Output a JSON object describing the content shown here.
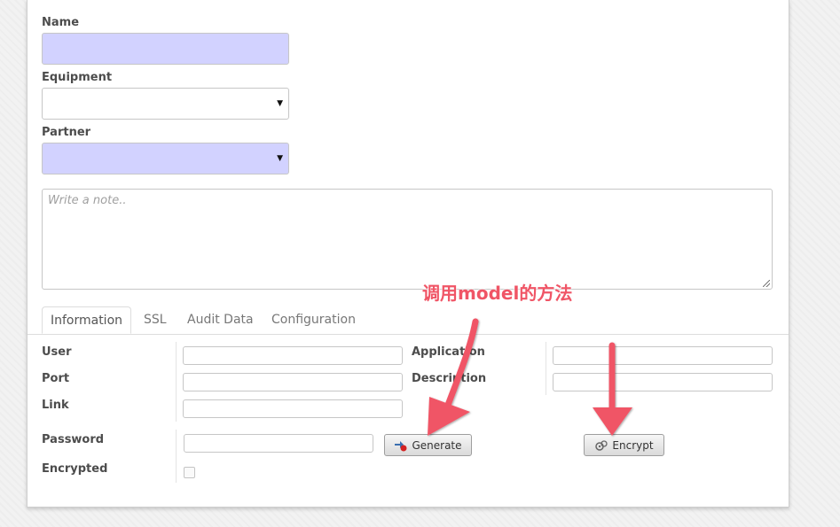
{
  "form": {
    "name_label": "Name",
    "name_value": "",
    "equipment_label": "Equipment",
    "equipment_value": "",
    "partner_label": "Partner",
    "partner_value": "",
    "note_placeholder": "Write a note..",
    "caret": "▼"
  },
  "tabs": [
    {
      "label": "Information",
      "active": true
    },
    {
      "label": "SSL",
      "active": false
    },
    {
      "label": "Audit Data",
      "active": false
    },
    {
      "label": "Configuration",
      "active": false
    }
  ],
  "info": {
    "user_label": "User",
    "port_label": "Port",
    "link_label": "Link",
    "application_label": "Application",
    "description_label": "Description",
    "password_label": "Password",
    "encrypted_label": "Encrypted",
    "encrypted_checked": false
  },
  "buttons": {
    "generate_label": "Generate",
    "encrypt_label": "Encrypt"
  },
  "annotation": {
    "text": "调用model的方法",
    "color": "#f05566"
  },
  "colors": {
    "required_field": "#d2d2ff",
    "arrow": "#f05566"
  }
}
